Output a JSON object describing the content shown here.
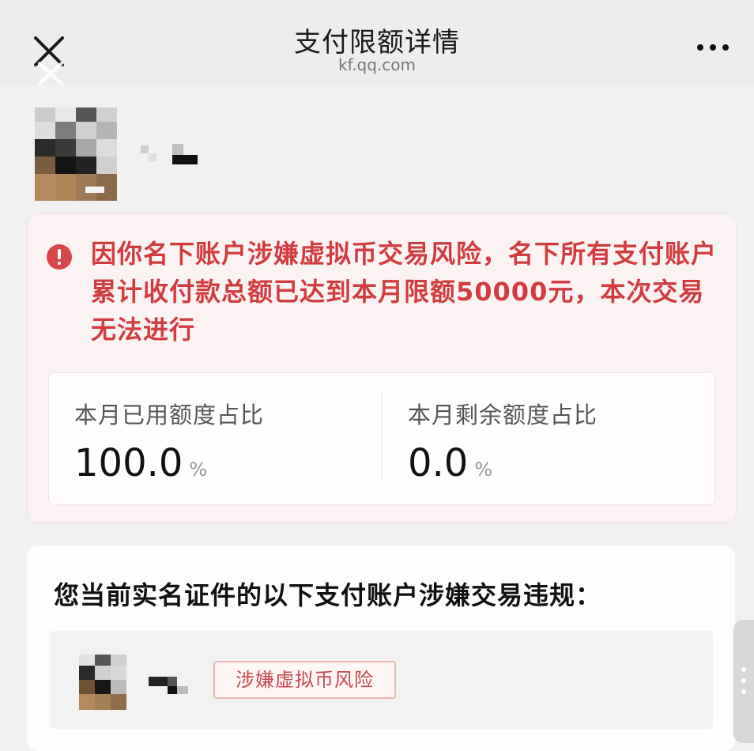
{
  "header": {
    "title": "支付限额详情",
    "domain": "kf.qq.com",
    "close_icon": "close-icon",
    "more_icon": "more-icon"
  },
  "warning": {
    "icon": "exclamation-icon",
    "text": "因你名下账户涉嫌虚拟币交易风险，名下所有支付账户累计收付款总额已达到本月限额50000元，本次交易无法进行"
  },
  "stats": {
    "used": {
      "label": "本月已用额度占比",
      "value": "100.0",
      "unit": "%"
    },
    "remaining": {
      "label": "本月剩余额度占比",
      "value": "0.0",
      "unit": "%"
    }
  },
  "accounts_section": {
    "title": "您当前实名证件的以下支付账户涉嫌交易违规：",
    "items": [
      {
        "tag": "涉嫌虚拟币风险"
      }
    ]
  },
  "colors": {
    "warning_red": "#d23c41",
    "card_bg": "#fbf3f3",
    "tag_border": "#e9b7b7"
  }
}
